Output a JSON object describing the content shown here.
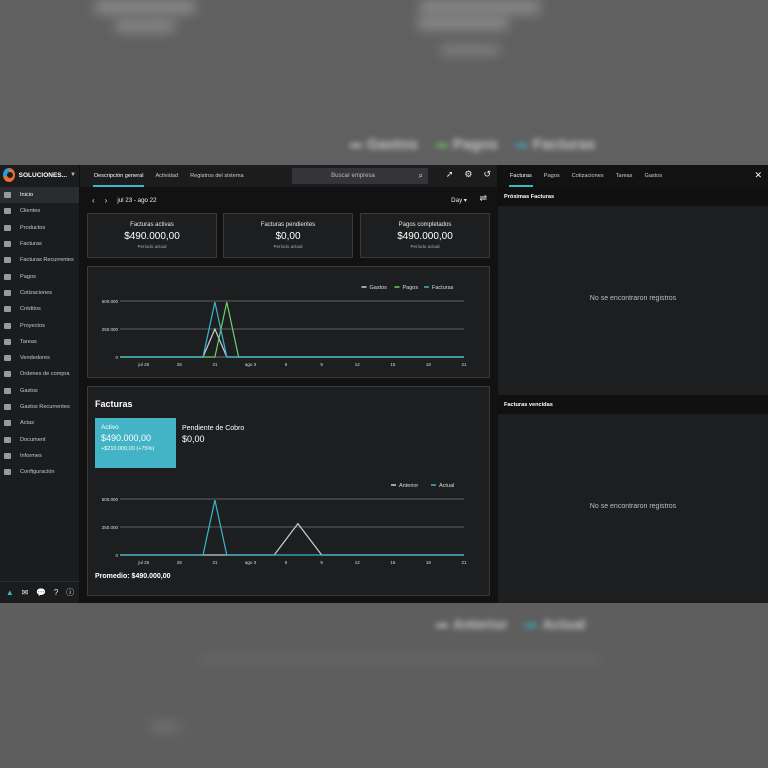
{
  "background": {
    "legend_top": [
      {
        "label": "Gastos",
        "color": "#cfcfcf"
      },
      {
        "label": "Pagos",
        "color": "#6fcf6a"
      },
      {
        "label": "Facturas",
        "color": "#3ab7c9"
      }
    ],
    "legend_bottom": [
      {
        "label": "Anterior",
        "color": "#cfcfcf"
      },
      {
        "label": "Actual",
        "color": "#3ab7c9"
      }
    ]
  },
  "sidebar": {
    "company": "SOLUCIONES...",
    "items": [
      {
        "label": "Inicio",
        "icon": "dashboard-icon",
        "active": true
      },
      {
        "label": "Clientes",
        "icon": "users-icon"
      },
      {
        "label": "Productos",
        "icon": "cube-icon"
      },
      {
        "label": "Facturas",
        "icon": "file-icon"
      },
      {
        "label": "Facturas Recurrentes",
        "icon": "file-icon"
      },
      {
        "label": "Pagos",
        "icon": "credit-card-icon"
      },
      {
        "label": "Cotizaciones",
        "icon": "file-icon"
      },
      {
        "label": "Créditos",
        "icon": "file-icon"
      },
      {
        "label": "Proyectos",
        "icon": "briefcase-icon"
      },
      {
        "label": "Tareas",
        "icon": "clock-icon"
      },
      {
        "label": "Vendedores",
        "icon": "building-icon"
      },
      {
        "label": "Ordenes de compra",
        "icon": "file-icon"
      },
      {
        "label": "Gastos",
        "icon": "file-icon"
      },
      {
        "label": "Gastos Recurrentes",
        "icon": "file-icon"
      },
      {
        "label": "Actas",
        "icon": "gavel-icon"
      },
      {
        "label": "Document",
        "icon": "image-icon"
      },
      {
        "label": "Informes",
        "icon": "chart-icon"
      },
      {
        "label": "Configuración",
        "icon": "gear-icon"
      }
    ],
    "footer_icons": [
      "triangle-icon",
      "mail-icon",
      "chat-icon",
      "help-icon",
      "info-icon"
    ]
  },
  "topbar": {
    "tabs": [
      "Descripción general",
      "Actividad",
      "Registros del sistema"
    ],
    "search_placeholder": "Buscar empresa"
  },
  "datebar": {
    "range": "jul 23 - ago 22",
    "period": "Day"
  },
  "stats": [
    {
      "title": "Facturas activas",
      "value": "$490.000,00",
      "sub": "Período actual"
    },
    {
      "title": "Facturas pendientes",
      "value": "$0,00",
      "sub": "Período actual"
    },
    {
      "title": "Pagos completados",
      "value": "$490.000,00",
      "sub": "Período actual"
    }
  ],
  "chart_data": [
    {
      "type": "line",
      "title": "",
      "legend": [
        "Gastos",
        "Pagos",
        "Facturas"
      ],
      "legend_position": "top-right",
      "x": [
        "jul 25",
        "28",
        "31",
        "ago 3",
        "6",
        "9",
        "12",
        "15",
        "18",
        "21"
      ],
      "ytick_labels": [
        "0",
        "250.000",
        "500.000"
      ],
      "ylim": [
        0,
        550000
      ],
      "grid": true,
      "series": [
        {
          "name": "Gastos",
          "color": "#cfcfcf",
          "points": [
            [
              7.0,
              0
            ],
            [
              8.0,
              250000
            ],
            [
              9.0,
              0
            ]
          ]
        },
        {
          "name": "Pagos",
          "color": "#6fcf6a",
          "points": [
            [
              8.0,
              0
            ],
            [
              9.0,
              490000
            ],
            [
              10.0,
              0
            ]
          ]
        },
        {
          "name": "Facturas",
          "color": "#3ab7c9",
          "points": [
            [
              7.0,
              0
            ],
            [
              8.0,
              490000
            ],
            [
              9.0,
              0
            ]
          ]
        }
      ]
    },
    {
      "type": "line",
      "title": "",
      "legend": [
        "Anterior",
        "Actual"
      ],
      "legend_position": "top-right",
      "x": [
        "jul 25",
        "28",
        "31",
        "ago 3",
        "6",
        "9",
        "12",
        "15",
        "18",
        "21"
      ],
      "ytick_labels": [
        "0",
        "250.000",
        "500.000"
      ],
      "ylim": [
        0,
        550000
      ],
      "grid": true,
      "series": [
        {
          "name": "Anterior",
          "color": "#cfcfcf",
          "points": [
            [
              13.0,
              0
            ],
            [
              15.0,
              280000
            ],
            [
              17.0,
              0
            ]
          ]
        },
        {
          "name": "Actual",
          "color": "#3ab7c9",
          "points": [
            [
              7.0,
              0
            ],
            [
              8.0,
              490000
            ],
            [
              9.0,
              0
            ]
          ]
        }
      ]
    }
  ],
  "facturas": {
    "title": "Facturas",
    "active_label": "Activo",
    "active_value": "$490.000,00",
    "active_delta": "+$210.000,00 (+75%)",
    "pending_label": "Pendiente de Cobro",
    "pending_value": "$0,00",
    "average": "Promedio: $490.000,00"
  },
  "rpanel": {
    "tabs": [
      "Facturas",
      "Pagos",
      "Cotizaciones",
      "Tareas",
      "Gastos"
    ],
    "sections": [
      {
        "title": "Próximas Facturas",
        "empty": "No se encontraron registros"
      },
      {
        "title": "Facturas vencidas",
        "empty": "No se encontraron registros"
      }
    ]
  }
}
